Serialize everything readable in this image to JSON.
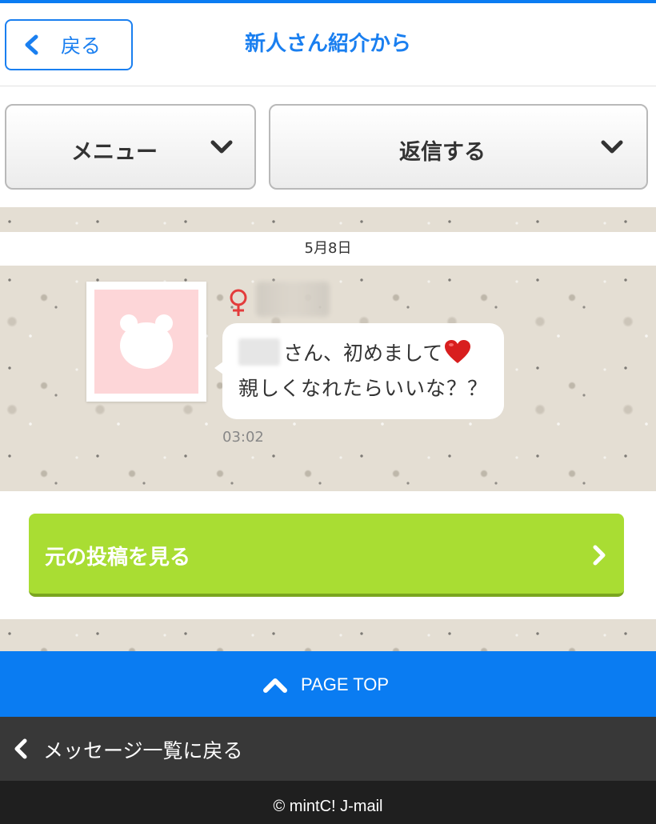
{
  "header": {
    "back_label": "戻る",
    "title": "新人さん紹介から"
  },
  "toolbar": {
    "menu_label": "メニュー",
    "reply_label": "返信する"
  },
  "thread": {
    "date": "5月8日",
    "message": {
      "sender_gender_icon": "female-symbol",
      "line1_suffix": "さん、初めまして",
      "line1_emoji": "red-heart",
      "line2": "親しくなれたらいいな？？",
      "time": "03:02"
    }
  },
  "original_post_button": {
    "label": "元の投稿を見る"
  },
  "page_top": {
    "label": "PAGE TOP"
  },
  "message_list_back": {
    "label": "メッセージ一覧に戻る"
  },
  "footer": {
    "copyright": "© mintC! J-mail"
  },
  "colors": {
    "accent_blue": "#0a7cf2",
    "button_green": "#a9dd33",
    "female_red": "#e33c3c",
    "avatar_pink": "#fdd6d8",
    "dark_bar": "#383838",
    "footer_bg": "#1f1f1f"
  }
}
